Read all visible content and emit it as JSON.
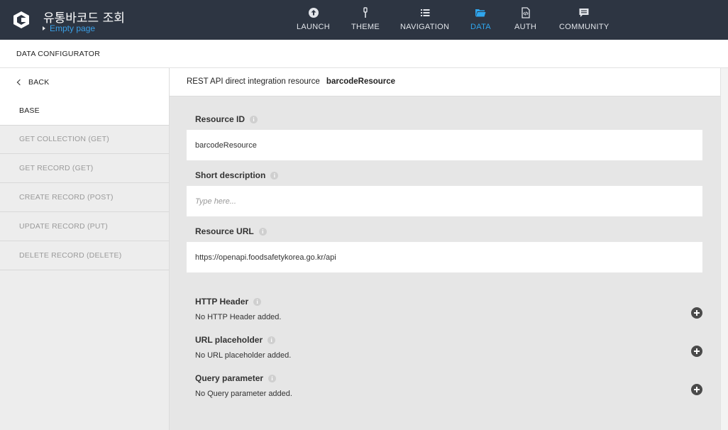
{
  "app": {
    "title": "유통바코드 조회",
    "breadcrumb": "Empty page"
  },
  "nav": [
    {
      "label": "LAUNCH",
      "icon": "upload-circle-icon",
      "active": false
    },
    {
      "label": "THEME",
      "icon": "brush-icon",
      "active": false
    },
    {
      "label": "NAVIGATION",
      "icon": "list-icon",
      "active": false
    },
    {
      "label": "DATA",
      "icon": "folder-icon",
      "active": true
    },
    {
      "label": "AUTH",
      "icon": "code-file-icon",
      "active": false
    },
    {
      "label": "COMMUNITY",
      "icon": "chat-icon",
      "active": false
    }
  ],
  "subheader": {
    "title": "DATA CONFIGURATOR"
  },
  "sidebar": {
    "back": "BACK",
    "items": [
      {
        "label": "BASE"
      },
      {
        "label": "GET COLLECTION (GET)"
      },
      {
        "label": "GET RECORD (GET)"
      },
      {
        "label": "CREATE RECORD (POST)"
      },
      {
        "label": "UPDATE RECORD (PUT)"
      },
      {
        "label": "DELETE RECORD (DELETE)"
      }
    ]
  },
  "main": {
    "header_prefix": "REST API direct integration resource",
    "header_name": "barcodeResource",
    "resource_id": {
      "label": "Resource ID",
      "value": "barcodeResource"
    },
    "short_description": {
      "label": "Short description",
      "placeholder": "Type here..."
    },
    "resource_url": {
      "label": "Resource URL",
      "value": "https://openapi.foodsafetykorea.go.kr/api"
    },
    "http_header": {
      "label": "HTTP Header",
      "empty_text": "No HTTP Header added."
    },
    "url_placeholder": {
      "label": "URL placeholder",
      "empty_text": "No URL placeholder added."
    },
    "query_parameter": {
      "label": "Query parameter",
      "empty_text": "No Query parameter added."
    }
  }
}
